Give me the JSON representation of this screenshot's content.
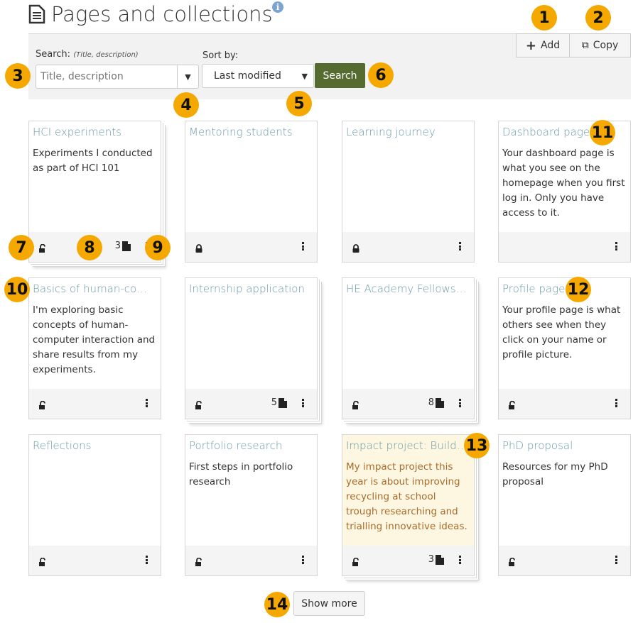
{
  "header": {
    "title": "Pages and collections",
    "info_icon": "info-icon"
  },
  "toolbar": {
    "add_label": "Add",
    "copy_label": "Copy"
  },
  "search": {
    "label": "Search:",
    "hint": "(Title, description)",
    "placeholder": "Title, description",
    "value": ""
  },
  "sort": {
    "label": "Sort by:",
    "selected": "Last modified",
    "button": "Search"
  },
  "cards": [
    {
      "title": "HCI experiments",
      "desc": "Experiments I conducted as part of HCI 101",
      "access": "unlocked",
      "pages": "3",
      "collection": true
    },
    {
      "title": "Mentoring students",
      "desc": "",
      "access": "locked",
      "collection": false
    },
    {
      "title": "Learning journey",
      "desc": "",
      "access": "locked",
      "collection": false
    },
    {
      "title": "Dashboard page",
      "desc": "Your dashboard page is what you see on the homepage when you first log in. Only you have access to it.",
      "access": "none",
      "collection": false
    },
    {
      "title": "Basics of human-comp...",
      "desc": "I'm exploring basic concepts of human-computer interaction and share results from my experiments.",
      "access": "unlocked",
      "collection": false
    },
    {
      "title": "Internship application",
      "desc": "",
      "access": "unlocked",
      "pages": "5",
      "collection": true
    },
    {
      "title": "HE Academy Fellowsh...",
      "desc": "",
      "access": "unlocked",
      "pages": "8",
      "collection": true
    },
    {
      "title": "Profile page",
      "desc": "Your profile page is what others see when they click on your name or profile picture.",
      "access": "unlocked",
      "collection": false
    },
    {
      "title": "Reflections",
      "desc": "",
      "access": "unlocked",
      "collection": false
    },
    {
      "title": "Portfolio research",
      "desc": "First steps in portfolio research",
      "access": "unlocked",
      "collection": false
    },
    {
      "title": "Impact project: Buildi...",
      "desc": "My impact project this year is about improving recycling at school trough researching and trialling innovative ideas.",
      "access": "unlocked",
      "pages": "3",
      "collection": true,
      "highlight": true
    },
    {
      "title": "PhD proposal",
      "desc": "Resources for my PhD proposal",
      "access": "unlocked",
      "collection": false
    }
  ],
  "show_more": "Show more",
  "callouts": [
    "1",
    "2",
    "3",
    "4",
    "5",
    "6",
    "7",
    "8",
    "9",
    "10",
    "11",
    "12",
    "13",
    "14"
  ],
  "colors": {
    "accent": "#f5a800",
    "search_button": "#556b2f",
    "card_title": "#6a9aa6",
    "highlight_bg": "#fdf6e1"
  }
}
